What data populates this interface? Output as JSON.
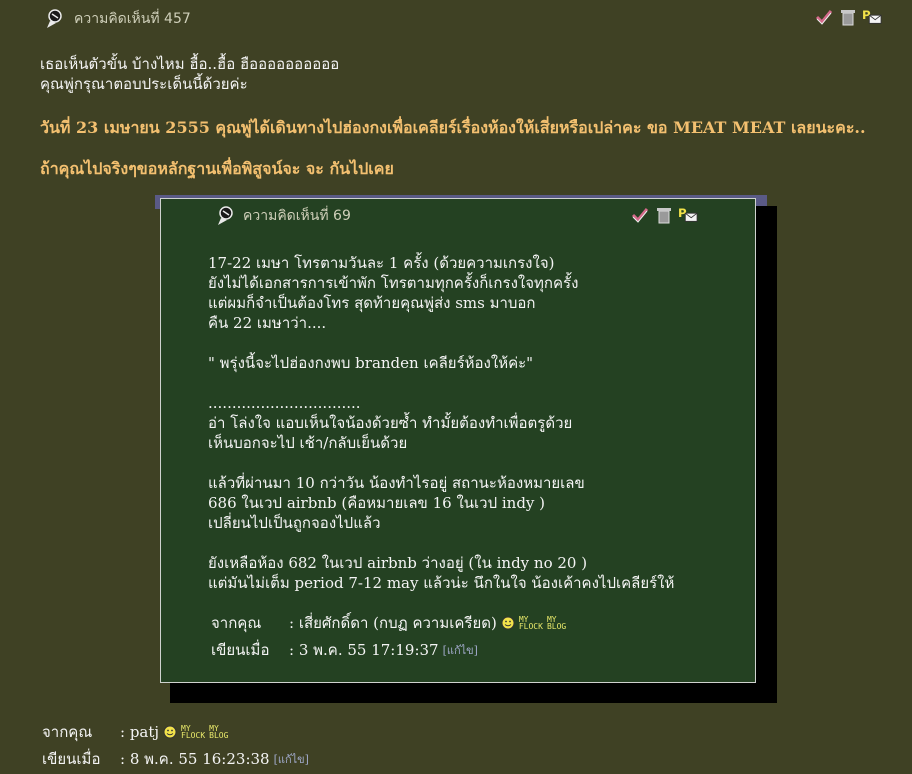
{
  "post": {
    "title": "ความคิดเห็นที่ 457",
    "lines": [
      "เธอเห็นตัวขั้น บ้างไหม  ฮื้อ..ฮื้อ ฮืออออออออออ",
      "คุณพู่กรุณาตอบประเด็นนี้ด้วยค่ะ"
    ],
    "highlight_1": "วันที่ 23 เมษายน 2555 คุณพู่ได้เดินทางไปฮ่องกงเพื่อเคลียร์เรื่องห้องให้เสี่ยหรือเปล่าคะ ขอ MEAT MEAT เลยนะคะ..",
    "highlight_2": "ถ้าคุณไปจริงๆขอหลักฐานเพื่อพิสูจน์จะ จะ กันไปเคย",
    "from_label": "จากคุณ",
    "from_value": ": patj",
    "time_label": "เขียนเมื่อ",
    "time_value": ": 8 พ.ค. 55 16:23:38",
    "edit_text": "[แก้ไข]"
  },
  "quote": {
    "title": "ความคิดเห็นที่ 69",
    "paragraphs": [
      [
        "17-22 เมษา โทรตามวันละ 1 ครั้ง (ด้วยความเกรงใจ)",
        "ยังไม่ได้เอกสารการเข้าพัก โทรตามทุกครั้งก็เกรงใจทุกครั้ง",
        "แต่ผมก็จำเป็นต้องโทร สุดท้ายคุณพู่ส่ง sms มาบอก",
        "คืน 22 เมษาว่า...."
      ],
      [
        "\" พรุ่งนี้จะไปฮ่องกงพบ branden เคลียร์ห้องให้ค่ะ\""
      ],
      [
        "................................",
        "อ่า โล่งใจ แอบเห็นใจน้องด้วยซ้ำ ทำมั้ยต้องทำเพื่อตรูด้วย",
        "เห็นบอกจะไป เช้า/กลับเย็นด้วย"
      ],
      [
        "แล้วที่ผ่านมา 10 กว่าวัน น้องทำไรอยู่ สถานะห้องหมายเลข",
        "686 ในเวป airbnb (คือหมายเลข 16 ในเวป indy )",
        "เปลี่ยนไปเป็นถูกจองไปแล้ว"
      ],
      [
        "ยังเหลือห้อง 682 ในเวป airbnb ว่างอยู่ (ใน indy no 20 )",
        "แต่มันไม่เต็ม period 7-12 may แล้วน่ะ นึกในใจ น้องเค้าคงไปเคลียร์ให้"
      ]
    ],
    "from_label": "จากคุณ",
    "from_value": ": เสี่ยศักดิ์ดา (กบฏ ความเครียด)",
    "time_label": "เขียนเมื่อ",
    "time_value": ": 3 พ.ค. 55 17:19:37",
    "edit_text": "[แก้ไข]"
  },
  "badge": {
    "my": "MY",
    "flock": "FLOCK",
    "blog": "BLOG"
  },
  "icons": [
    "pin-icon",
    "vote-check-icon",
    "trash-icon",
    "private-message-icon",
    "smiley-icon"
  ],
  "colors": {
    "background": "#3f4124",
    "quote_bg": "#244122",
    "highlight": "#f3c070"
  }
}
